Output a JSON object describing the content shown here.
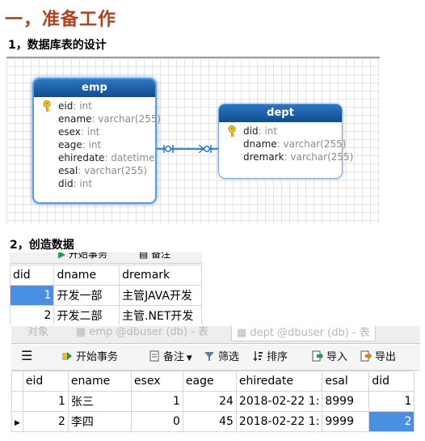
{
  "heading": "一，准备工作",
  "section1": "1，数据库表的设计",
  "section2": "2，创造数据",
  "er": {
    "emp": {
      "name": "emp",
      "fields": [
        {
          "name": "eid",
          "type": ": int",
          "key": true
        },
        {
          "name": "ename",
          "type": ": varchar(255)",
          "key": false
        },
        {
          "name": "esex",
          "type": ": int",
          "key": false
        },
        {
          "name": "eage",
          "type": ": int",
          "key": false
        },
        {
          "name": "ehiredate",
          "type": ": datetime",
          "key": false
        },
        {
          "name": "esal",
          "type": ": varchar(255)",
          "key": false
        },
        {
          "name": "did",
          "type": ": int",
          "key": false
        }
      ]
    },
    "dept": {
      "name": "dept",
      "fields": [
        {
          "name": "did",
          "type": ": int",
          "key": true
        },
        {
          "name": "dname",
          "type": ": varchar(255)",
          "key": false
        },
        {
          "name": "dremark",
          "type": ": varchar(255)",
          "key": false
        }
      ]
    }
  },
  "dept_grid": {
    "toolbar": {
      "begin": "开始事务",
      "note": "备注"
    },
    "columns": [
      "did",
      "dname",
      "dremark"
    ],
    "rows": [
      [
        "1",
        "开发一部",
        "主管JAVA开发"
      ],
      [
        "2",
        "开发二部",
        "主管.NET开发"
      ]
    ]
  },
  "emp_grid": {
    "tabs": {
      "objects": "对象",
      "tab1": "emp @dbuser (db) - 表",
      "tab2": "dept @dbuser (db) - 表"
    },
    "toolbar": {
      "begin": "开始事务",
      "note": "备注",
      "filter": "筛选",
      "sort": "排序",
      "import": "导入",
      "export": "导出"
    },
    "columns": [
      "eid",
      "ename",
      "esex",
      "eage",
      "ehiredate",
      "esal",
      "did"
    ],
    "rows": [
      [
        "1",
        "张三",
        "1",
        "24",
        "2018-02-22 1:",
        "8999",
        "1"
      ],
      [
        "2",
        "李四",
        "0",
        "45",
        "2018-02-22 1:",
        "9999",
        "2"
      ]
    ]
  },
  "colors": {
    "heading": "#b0411e",
    "entity_header": "#0f4c93",
    "selection": "#4a90e2"
  }
}
